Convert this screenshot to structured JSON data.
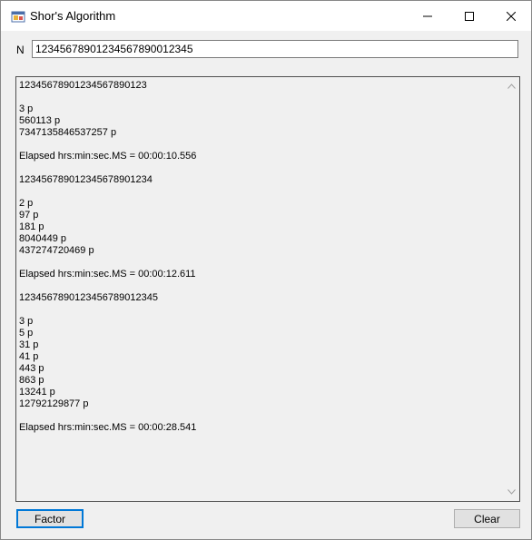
{
  "window": {
    "title": "Shor's Algorithm",
    "icons": {
      "app": "app-icon",
      "minimize": "minimize-icon",
      "maximize": "maximize-icon",
      "close": "close-icon"
    }
  },
  "input": {
    "label": "N",
    "value": "12345678901234567890012345"
  },
  "output": {
    "text": "12345678901234567890123\n\n3 p\n560113 p\n7347135846537257 p\n\nElapsed hrs:min:sec.MS = 00:00:10.556\n\n123456789012345678901234\n\n2 p\n97 p\n181 p\n8040449 p\n437274720469 p\n\nElapsed hrs:min:sec.MS = 00:00:12.611\n\n1234567890123456789012345\n\n3 p\n5 p\n31 p\n41 p\n443 p\n863 p\n13241 p\n12792129877 p\n\nElapsed hrs:min:sec.MS = 00:00:28.541"
  },
  "buttons": {
    "factor": "Factor",
    "clear": "Clear"
  },
  "colors": {
    "focus_border": "#0078d7",
    "button_bg": "#e1e1e1",
    "window_bg": "#f0f0f0"
  }
}
